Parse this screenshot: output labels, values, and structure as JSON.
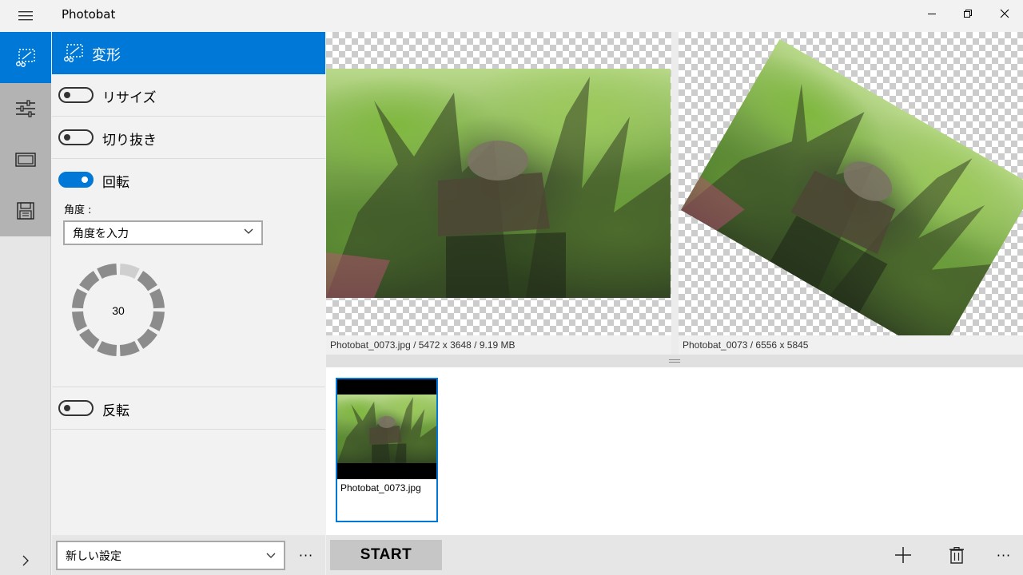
{
  "window": {
    "title": "Photobat"
  },
  "rail": {
    "items": [
      {
        "icon": "transform-icon",
        "active": true
      },
      {
        "icon": "adjust-sliders-icon",
        "active": false
      },
      {
        "icon": "frame-icon",
        "active": false
      },
      {
        "icon": "save-icon",
        "active": false
      }
    ],
    "expand_icon": "chevron-right-icon"
  },
  "panel": {
    "title": "変形",
    "resize": {
      "label": "リサイズ",
      "on": false
    },
    "crop": {
      "label": "切り抜き",
      "on": false
    },
    "rotate": {
      "label": "回転",
      "on": true,
      "angle_label": "角度 :",
      "angle_select": "角度を入力",
      "dial_value": "30"
    },
    "flip": {
      "label": "反転",
      "on": false
    },
    "preset_select": "新しい設定",
    "more_label": "···"
  },
  "preview": {
    "original_caption": "Photobat_0073.jpg / 5472 x 3648 / 9.19 MB",
    "result_caption": "Photobat_0073 / 6556 x 5845"
  },
  "files": [
    {
      "name": "Photobat_0073.jpg",
      "selected": true
    }
  ],
  "bottombar": {
    "start_label": "START",
    "more_label": "···"
  },
  "colors": {
    "accent": "#0078d7",
    "rail_grey": "#b3b3b3"
  }
}
